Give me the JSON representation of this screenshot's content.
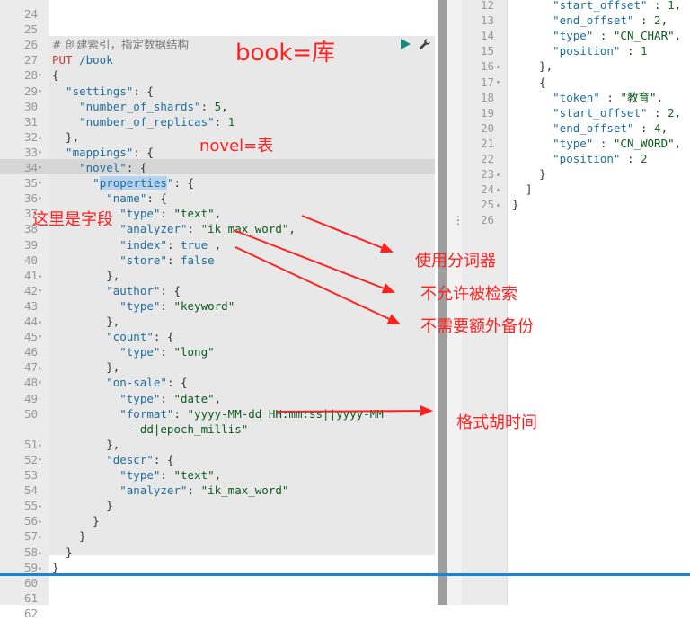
{
  "request_editor": {
    "lines": [
      {
        "n": "24",
        "fold": "",
        "parts": []
      },
      {
        "n": "25",
        "fold": "",
        "parts": []
      },
      {
        "n": "26",
        "fold": "",
        "parts": [
          {
            "t": "# 创建索引，指定数据结构",
            "c": "cm"
          }
        ]
      },
      {
        "n": "27",
        "fold": "",
        "parts": [
          {
            "t": "PUT",
            "c": "kw"
          },
          {
            "t": " /book",
            "c": "path"
          }
        ]
      },
      {
        "n": "28",
        "fold": "▾",
        "parts": [
          {
            "t": "{",
            "c": "punc"
          }
        ]
      },
      {
        "n": "29",
        "fold": "▾",
        "parts": [
          {
            "t": "  \"settings\"",
            "c": "key"
          },
          {
            "t": ": {",
            "c": "punc"
          }
        ]
      },
      {
        "n": "30",
        "fold": "",
        "parts": [
          {
            "t": "    \"number_of_shards\"",
            "c": "key"
          },
          {
            "t": ": ",
            "c": "punc"
          },
          {
            "t": "5",
            "c": "num"
          },
          {
            "t": ",",
            "c": "punc"
          }
        ]
      },
      {
        "n": "31",
        "fold": "",
        "parts": [
          {
            "t": "    \"number_of_replicas\"",
            "c": "key"
          },
          {
            "t": ": ",
            "c": "punc"
          },
          {
            "t": "1",
            "c": "num"
          }
        ]
      },
      {
        "n": "32",
        "fold": "▴",
        "parts": [
          {
            "t": "  },",
            "c": "punc"
          }
        ]
      },
      {
        "n": "33",
        "fold": "▾",
        "parts": [
          {
            "t": "  \"mappings\"",
            "c": "key"
          },
          {
            "t": ": {",
            "c": "punc"
          }
        ]
      },
      {
        "n": "34",
        "fold": "▾",
        "parts": [
          {
            "t": "    \"novel\"",
            "c": "key"
          },
          {
            "t": ": {",
            "c": "punc"
          }
        ]
      },
      {
        "n": "35",
        "fold": "▾",
        "parts": [
          {
            "t": "      \"",
            "c": "key"
          },
          {
            "t": "properties",
            "c": "key sel"
          },
          {
            "t": "\"",
            "c": "key"
          },
          {
            "t": ": {",
            "c": "punc"
          }
        ]
      },
      {
        "n": "36",
        "fold": "▾",
        "parts": [
          {
            "t": "        \"name\"",
            "c": "key"
          },
          {
            "t": ": {",
            "c": "punc"
          }
        ]
      },
      {
        "n": "37",
        "fold": "",
        "parts": [
          {
            "t": "          \"type\"",
            "c": "key"
          },
          {
            "t": ": ",
            "c": "punc"
          },
          {
            "t": "\"text\"",
            "c": "str"
          },
          {
            "t": ",",
            "c": "punc"
          }
        ]
      },
      {
        "n": "38",
        "fold": "",
        "parts": [
          {
            "t": "          \"analyzer\"",
            "c": "key"
          },
          {
            "t": ": ",
            "c": "punc"
          },
          {
            "t": "\"ik_max_word\"",
            "c": "str"
          },
          {
            "t": ",",
            "c": "punc"
          }
        ]
      },
      {
        "n": "39",
        "fold": "",
        "parts": [
          {
            "t": "          \"index\"",
            "c": "key"
          },
          {
            "t": ": ",
            "c": "punc"
          },
          {
            "t": "true",
            "c": "bool"
          },
          {
            "t": " ,",
            "c": "punc"
          }
        ]
      },
      {
        "n": "40",
        "fold": "",
        "parts": [
          {
            "t": "          \"store\"",
            "c": "key"
          },
          {
            "t": ": ",
            "c": "punc"
          },
          {
            "t": "false",
            "c": "bool"
          }
        ]
      },
      {
        "n": "41",
        "fold": "▴",
        "parts": [
          {
            "t": "        },",
            "c": "punc"
          }
        ]
      },
      {
        "n": "42",
        "fold": "▾",
        "parts": [
          {
            "t": "        \"author\"",
            "c": "key"
          },
          {
            "t": ": {",
            "c": "punc"
          }
        ]
      },
      {
        "n": "43",
        "fold": "",
        "parts": [
          {
            "t": "          \"type\"",
            "c": "key"
          },
          {
            "t": ": ",
            "c": "punc"
          },
          {
            "t": "\"keyword\"",
            "c": "str"
          }
        ]
      },
      {
        "n": "44",
        "fold": "▴",
        "parts": [
          {
            "t": "        },",
            "c": "punc"
          }
        ]
      },
      {
        "n": "45",
        "fold": "▾",
        "parts": [
          {
            "t": "        \"count\"",
            "c": "key"
          },
          {
            "t": ": {",
            "c": "punc"
          }
        ]
      },
      {
        "n": "46",
        "fold": "",
        "parts": [
          {
            "t": "          \"type\"",
            "c": "key"
          },
          {
            "t": ": ",
            "c": "punc"
          },
          {
            "t": "\"long\"",
            "c": "str"
          }
        ]
      },
      {
        "n": "47",
        "fold": "▴",
        "parts": [
          {
            "t": "        },",
            "c": "punc"
          }
        ]
      },
      {
        "n": "48",
        "fold": "▾",
        "parts": [
          {
            "t": "        \"on-sale\"",
            "c": "key"
          },
          {
            "t": ": {",
            "c": "punc"
          }
        ]
      },
      {
        "n": "49",
        "fold": "",
        "parts": [
          {
            "t": "          \"type\"",
            "c": "key"
          },
          {
            "t": ": ",
            "c": "punc"
          },
          {
            "t": "\"date\"",
            "c": "str"
          },
          {
            "t": ",",
            "c": "punc"
          }
        ]
      },
      {
        "n": "50",
        "fold": "",
        "parts": [
          {
            "t": "          \"format\"",
            "c": "key"
          },
          {
            "t": ": ",
            "c": "punc"
          },
          {
            "t": "\"yyyy-MM-dd HH:mm:ss||yyyy-MM",
            "c": "str"
          }
        ]
      },
      {
        "n": "",
        "fold": "",
        "parts": [
          {
            "t": "            -dd|epoch_millis\"",
            "c": "str"
          }
        ]
      },
      {
        "n": "51",
        "fold": "▴",
        "parts": [
          {
            "t": "        },",
            "c": "punc"
          }
        ]
      },
      {
        "n": "52",
        "fold": "▾",
        "parts": [
          {
            "t": "        \"descr\"",
            "c": "key"
          },
          {
            "t": ": {",
            "c": "punc"
          }
        ]
      },
      {
        "n": "53",
        "fold": "",
        "parts": [
          {
            "t": "          \"type\"",
            "c": "key"
          },
          {
            "t": ": ",
            "c": "punc"
          },
          {
            "t": "\"text\"",
            "c": "str"
          },
          {
            "t": ",",
            "c": "punc"
          }
        ]
      },
      {
        "n": "54",
        "fold": "",
        "parts": [
          {
            "t": "          \"analyzer\"",
            "c": "key"
          },
          {
            "t": ": ",
            "c": "punc"
          },
          {
            "t": "\"ik_max_word\"",
            "c": "str"
          }
        ]
      },
      {
        "n": "55",
        "fold": "▴",
        "parts": [
          {
            "t": "        }",
            "c": "punc"
          }
        ]
      },
      {
        "n": "56",
        "fold": "▴",
        "parts": [
          {
            "t": "      }",
            "c": "punc"
          }
        ]
      },
      {
        "n": "57",
        "fold": "▴",
        "parts": [
          {
            "t": "    }",
            "c": "punc"
          }
        ]
      },
      {
        "n": "58",
        "fold": "▴",
        "parts": [
          {
            "t": "  }",
            "c": "punc"
          }
        ]
      },
      {
        "n": "59",
        "fold": "▴",
        "parts": [
          {
            "t": "}",
            "c": "punc"
          }
        ]
      },
      {
        "n": "60",
        "fold": "",
        "parts": []
      },
      {
        "n": "61",
        "fold": "",
        "parts": []
      },
      {
        "n": "62",
        "fold": "",
        "parts": []
      }
    ]
  },
  "response_panel": {
    "lines": [
      {
        "n": "12",
        "fold": "",
        "parts": [
          {
            "t": "      \"start_offset\"",
            "c": "key"
          },
          {
            "t": " : ",
            "c": "punc"
          },
          {
            "t": "1",
            "c": "num"
          },
          {
            "t": ",",
            "c": "punc"
          }
        ]
      },
      {
        "n": "13",
        "fold": "",
        "parts": [
          {
            "t": "      \"end_offset\"",
            "c": "key"
          },
          {
            "t": " : ",
            "c": "punc"
          },
          {
            "t": "2",
            "c": "num"
          },
          {
            "t": ",",
            "c": "punc"
          }
        ]
      },
      {
        "n": "14",
        "fold": "",
        "parts": [
          {
            "t": "      \"type\"",
            "c": "key"
          },
          {
            "t": " : ",
            "c": "punc"
          },
          {
            "t": "\"CN_CHAR\"",
            "c": "str"
          },
          {
            "t": ",",
            "c": "punc"
          }
        ]
      },
      {
        "n": "15",
        "fold": "",
        "parts": [
          {
            "t": "      \"position\"",
            "c": "key"
          },
          {
            "t": " : ",
            "c": "punc"
          },
          {
            "t": "1",
            "c": "num"
          }
        ]
      },
      {
        "n": "16",
        "fold": "▴",
        "parts": [
          {
            "t": "    },",
            "c": "punc"
          }
        ]
      },
      {
        "n": "17",
        "fold": "▾",
        "parts": [
          {
            "t": "    {",
            "c": "punc"
          }
        ]
      },
      {
        "n": "18",
        "fold": "",
        "parts": [
          {
            "t": "      \"token\"",
            "c": "key"
          },
          {
            "t": " : ",
            "c": "punc"
          },
          {
            "t": "\"教育\"",
            "c": "str"
          },
          {
            "t": ",",
            "c": "punc"
          }
        ]
      },
      {
        "n": "19",
        "fold": "",
        "parts": [
          {
            "t": "      \"start_offset\"",
            "c": "key"
          },
          {
            "t": " : ",
            "c": "punc"
          },
          {
            "t": "2",
            "c": "num"
          },
          {
            "t": ",",
            "c": "punc"
          }
        ]
      },
      {
        "n": "20",
        "fold": "",
        "parts": [
          {
            "t": "      \"end_offset\"",
            "c": "key"
          },
          {
            "t": " : ",
            "c": "punc"
          },
          {
            "t": "4",
            "c": "num"
          },
          {
            "t": ",",
            "c": "punc"
          }
        ]
      },
      {
        "n": "21",
        "fold": "",
        "parts": [
          {
            "t": "      \"type\"",
            "c": "key"
          },
          {
            "t": " : ",
            "c": "punc"
          },
          {
            "t": "\"CN_WORD\"",
            "c": "str"
          },
          {
            "t": ",",
            "c": "punc"
          }
        ]
      },
      {
        "n": "22",
        "fold": "",
        "parts": [
          {
            "t": "      \"position\"",
            "c": "key"
          },
          {
            "t": " : ",
            "c": "punc"
          },
          {
            "t": "2",
            "c": "num"
          }
        ]
      },
      {
        "n": "23",
        "fold": "▴",
        "parts": [
          {
            "t": "    }",
            "c": "punc"
          }
        ]
      },
      {
        "n": "24",
        "fold": "▴",
        "parts": [
          {
            "t": "  ]",
            "c": "punc"
          }
        ]
      },
      {
        "n": "25",
        "fold": "▴",
        "parts": [
          {
            "t": "}",
            "c": "punc"
          }
        ]
      },
      {
        "n": "26",
        "fold": "",
        "parts": []
      }
    ]
  },
  "toolbar": {
    "run_icon": "play-icon",
    "settings_icon": "wrench-icon"
  },
  "annotations": {
    "book_eq_index": "book=库",
    "novel_eq_table": "novel=表",
    "here_are_fields": "这里是字段",
    "use_analyzer": "使用分词器",
    "not_indexed": "不允许被检索",
    "no_backup": "不需要额外备份",
    "format_time": "格式胡时间"
  },
  "colors": {
    "annotation": "#ff2020",
    "selection": "#b7d2ef",
    "accent_line": "#1a83d6"
  }
}
